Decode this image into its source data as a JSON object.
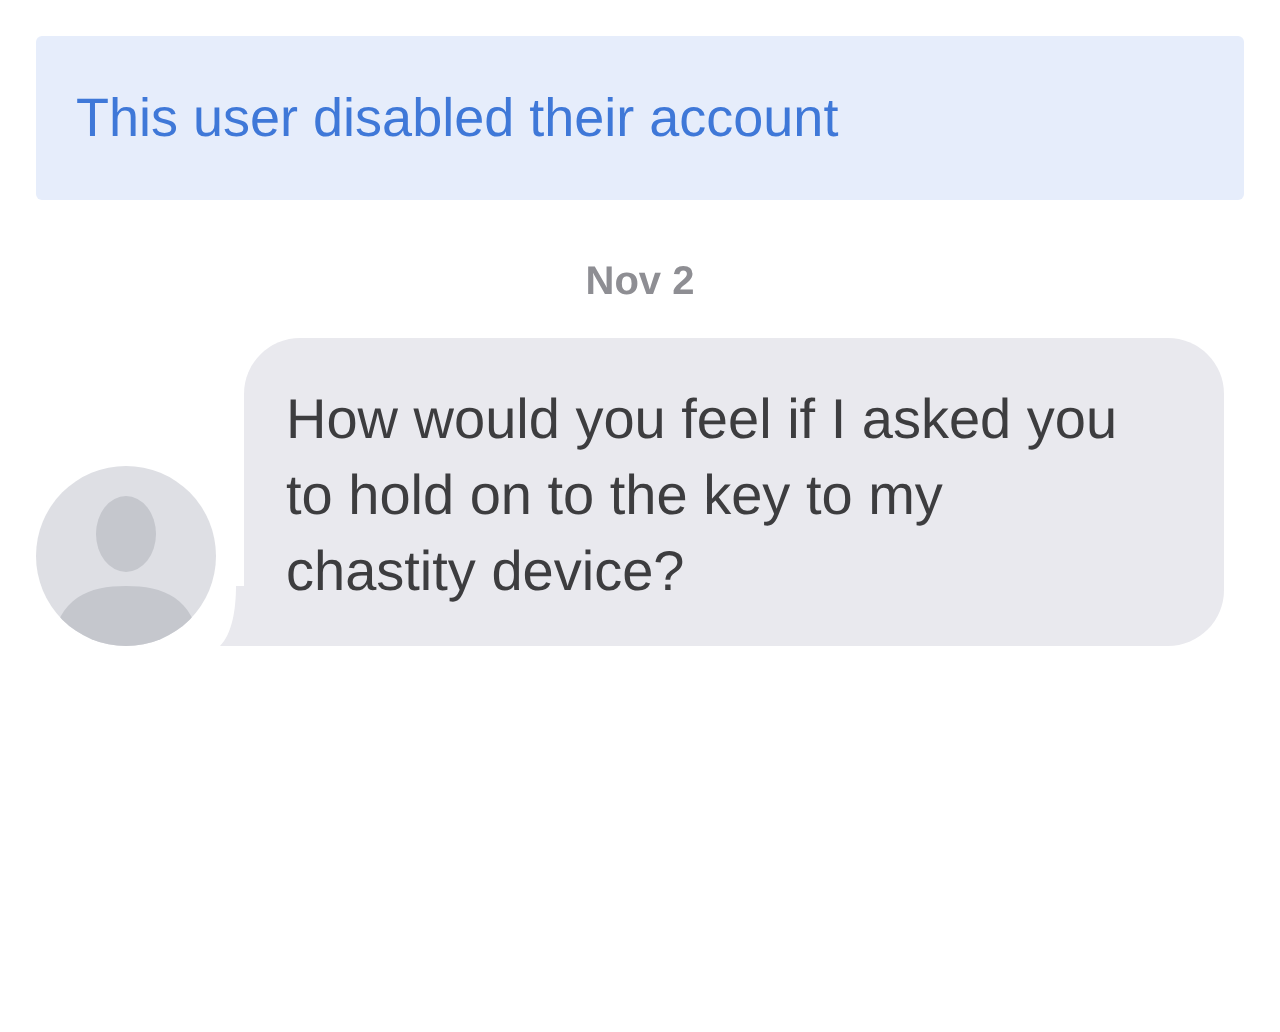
{
  "notice": {
    "text": "This user disabled their account"
  },
  "messages": [
    {
      "date": "Nov 2",
      "text": "How would you feel if I asked you to hold on to the key to my chastity device?"
    }
  ]
}
